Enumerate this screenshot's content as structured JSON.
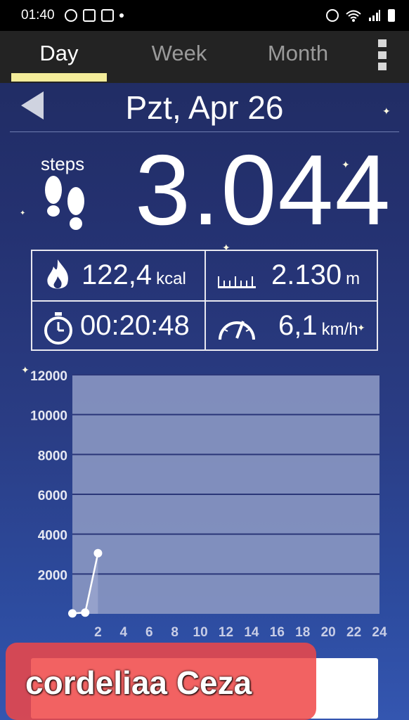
{
  "status_bar": {
    "time": "01:40",
    "left_icons": [
      "whatsapp-icon",
      "gmail-icon",
      "voicemail-icon",
      "dot-icon"
    ],
    "right_icons": [
      "alarm-icon",
      "wifi-icon",
      "signal-icon",
      "battery-icon"
    ]
  },
  "tabs": [
    {
      "label": "Day",
      "active": true
    },
    {
      "label": "Week",
      "active": false
    },
    {
      "label": "Month",
      "active": false
    }
  ],
  "date": "Pzt, Apr 26",
  "steps": {
    "label": "steps",
    "value": "3.044"
  },
  "stats": {
    "calories": {
      "value": "122,4",
      "unit": "kcal"
    },
    "distance": {
      "value": "2.130",
      "unit": "m"
    },
    "duration": {
      "value": "00:20:48"
    },
    "speed": {
      "value": "6,1",
      "unit": "km/h"
    }
  },
  "chart_data": {
    "type": "line",
    "x": [
      0,
      1,
      2
    ],
    "values": [
      20,
      60,
      3044
    ],
    "xticks": [
      "2",
      "4",
      "6",
      "8",
      "10",
      "12",
      "14",
      "16",
      "18",
      "20",
      "22",
      "24"
    ],
    "yticks": [
      "2000",
      "4000",
      "6000",
      "8000",
      "10000",
      "12000"
    ],
    "xlim": [
      0,
      24
    ],
    "ylim": [
      0,
      12000
    ],
    "grid": true
  },
  "ad": {
    "text": "cordeliaa Ceza"
  },
  "colors": {
    "tab_indicator": "#f3ec9a",
    "plot_area": "#8a97c2",
    "grid": "#2a3678"
  }
}
